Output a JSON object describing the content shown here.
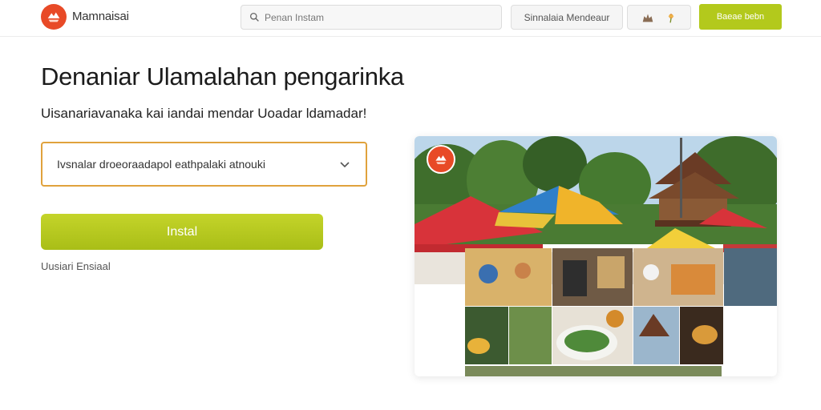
{
  "header": {
    "brand": "Mamnaisai",
    "search_placeholder": "Penan Instam",
    "nav_link": "Sinnalaia Mendeaur",
    "cta": "Baeae bebn",
    "icons": [
      "cake-icon",
      "flower-icon"
    ]
  },
  "main": {
    "title": "Denaniar Ulamalahan pengarinka",
    "subtitle": "Uisanariavanaka kai iandai mendar Uoadar ldamadar!",
    "select_value": "Ivsnalar droeoraadapol eathpalaki atnouki",
    "install_label": "Instal",
    "footnote": "Uusiari Ensiaal"
  },
  "colors": {
    "brand": "#e84a27",
    "accent": "#b3c91c",
    "select_border": "#e0a23c"
  }
}
